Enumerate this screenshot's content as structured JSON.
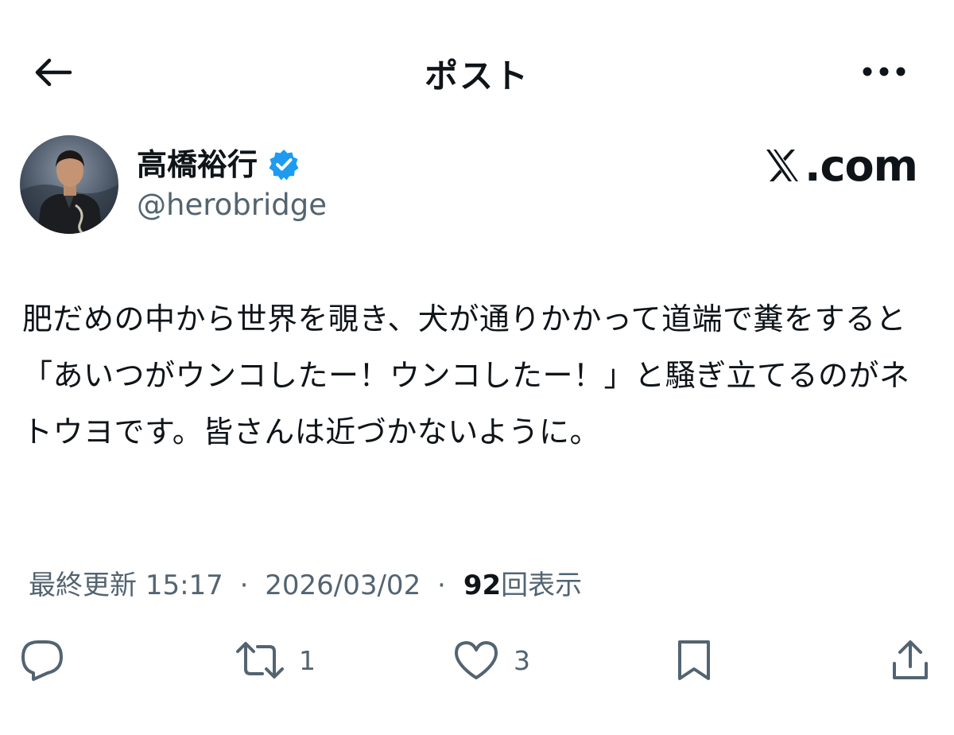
{
  "header": {
    "title": "ポスト"
  },
  "author": {
    "display_name": "高橋裕行",
    "handle": "@herobridge",
    "verified": true
  },
  "brand": {
    "suffix": ".com"
  },
  "tweet": {
    "text": "肥だめの中から世界を覗き、犬が通りかかって道端で糞をすると「あいつがウンコしたー！ウンコしたー！」と騒ぎ立てるのがネトウヨです。皆さんは近づかないように。"
  },
  "meta": {
    "prefix": "最終更新",
    "time": "15:17",
    "separator": "·",
    "date": "2026/03/02",
    "view_count": "92",
    "view_label": "回表示"
  },
  "actions": {
    "reply_count": "",
    "repost_count": "1",
    "like_count": "3"
  },
  "icons": {
    "back": "arrow-left-icon",
    "more": "more-horizontal-icon",
    "verified": "verified-badge-icon",
    "reply": "reply-icon",
    "repost": "repost-icon",
    "like": "heart-icon",
    "bookmark": "bookmark-icon",
    "share": "share-icon"
  },
  "colors": {
    "text": "#0f1419",
    "secondary": "#536471",
    "verified": "#1d9bf0"
  }
}
